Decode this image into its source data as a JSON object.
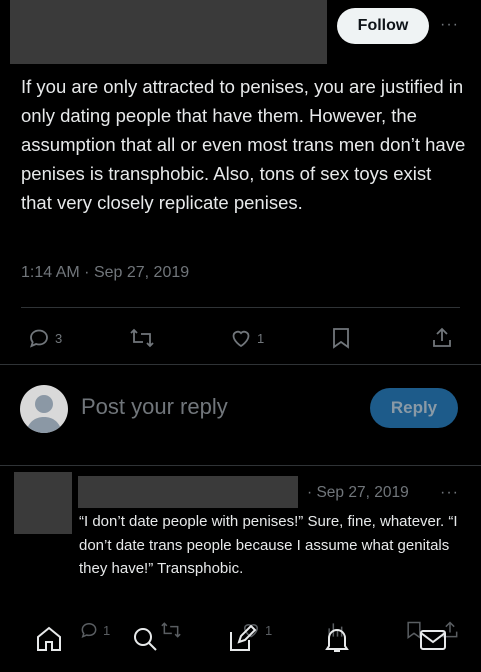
{
  "header": {
    "follow_label": "Follow",
    "more_label": "···"
  },
  "tweet": {
    "text": "If you are only attracted to penises, you are justified in only dating people that have them. However, the assumption that all or even most trans men don’t have penises is transphobic. Also, tons of sex toys exist that very closely replicate penises.",
    "time": "1:14 AM",
    "separator": "·",
    "date": "Sep 27, 2019"
  },
  "actions": {
    "replies": "3",
    "retweets": "",
    "likes": "1"
  },
  "reply_box": {
    "placeholder": "Post your reply",
    "button_label": "Reply"
  },
  "reply_tweet": {
    "date": "· Sep 27, 2019",
    "more_label": "···",
    "text": "“I don’t date people with penises!” Sure, fine, whatever. “I don’t date trans people because I assume what genitals they have!” Transphobic.",
    "reply_count": "1",
    "like_count": "1"
  },
  "icons": {
    "reply": "reply-icon",
    "retweet": "retweet-icon",
    "like": "heart-icon",
    "bookmark": "bookmark-icon",
    "share": "share-icon",
    "home": "home-icon",
    "search": "search-icon",
    "compose": "compose-icon",
    "notifications": "bell-icon",
    "messages": "mail-icon"
  },
  "colors": {
    "background": "#000000",
    "text": "#e7e9ea",
    "muted": "#71767b",
    "accent": "#1d9bf0"
  }
}
